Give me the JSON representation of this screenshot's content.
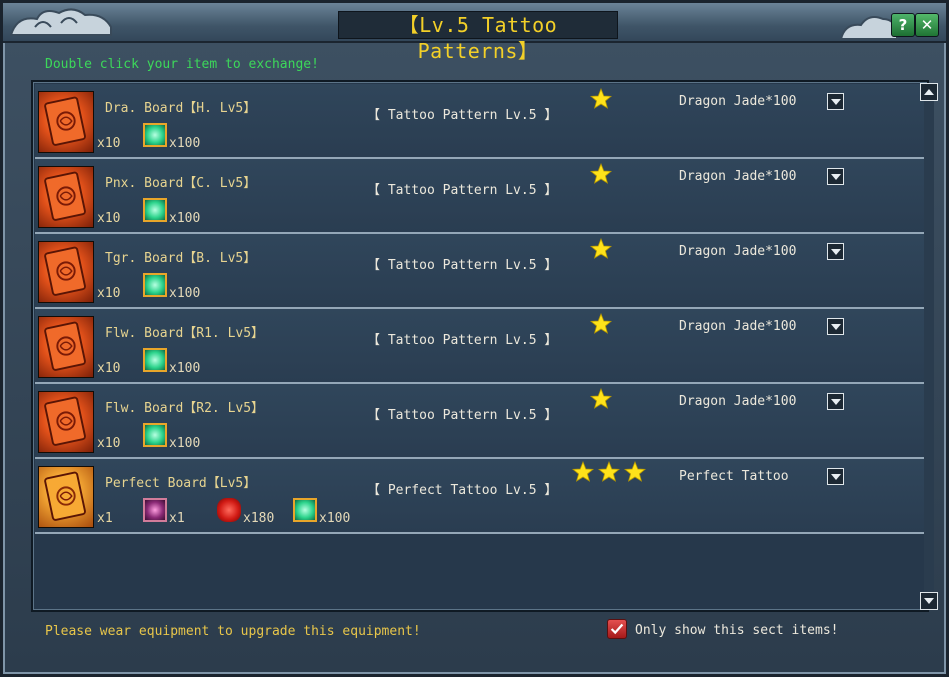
{
  "window": {
    "title": "【Lv.5 Tattoo Patterns】",
    "hint": "Double click your item to exchange!",
    "help_label": "?",
    "close_label": "✕"
  },
  "rows": [
    {
      "item_name": "Dra. Board【H. Lv5】",
      "item_qty": "x10",
      "materials": [
        {
          "type": "jade",
          "qty": "x100"
        }
      ],
      "pattern": "【 Tattoo Pattern Lv.5 】",
      "stars": 1,
      "cost": "Dragon Jade*100"
    },
    {
      "item_name": "Pnx. Board【C. Lv5】",
      "item_qty": "x10",
      "materials": [
        {
          "type": "jade",
          "qty": "x100"
        }
      ],
      "pattern": "【 Tattoo Pattern Lv.5 】",
      "stars": 1,
      "cost": "Dragon Jade*100"
    },
    {
      "item_name": "Tgr. Board【B. Lv5】",
      "item_qty": "x10",
      "materials": [
        {
          "type": "jade",
          "qty": "x100"
        }
      ],
      "pattern": "【 Tattoo Pattern Lv.5 】",
      "stars": 1,
      "cost": "Dragon Jade*100"
    },
    {
      "item_name": "Flw. Board【R1. Lv5】",
      "item_qty": "x10",
      "materials": [
        {
          "type": "jade",
          "qty": "x100"
        }
      ],
      "pattern": "【 Tattoo Pattern Lv.5 】",
      "stars": 1,
      "cost": "Dragon Jade*100"
    },
    {
      "item_name": "Flw. Board【R2. Lv5】",
      "item_qty": "x10",
      "materials": [
        {
          "type": "jade",
          "qty": "x100"
        }
      ],
      "pattern": "【 Tattoo Pattern Lv.5 】",
      "stars": 1,
      "cost": "Dragon Jade*100"
    },
    {
      "item_name": "Perfect Board【Lv5】",
      "item_qty": "x1",
      "materials": [
        {
          "type": "purple",
          "qty": "x1"
        },
        {
          "type": "redgem",
          "qty": "x180"
        },
        {
          "type": "jade",
          "qty": "x100"
        }
      ],
      "pattern": "【 Perfect Tattoo Lv.5 】",
      "stars": 3,
      "cost": "Perfect Tattoo"
    }
  ],
  "footer": {
    "message": "Please wear equipment to upgrade this equipment!",
    "checkbox_label": "Only show this sect items!",
    "checkbox_checked": true
  },
  "colors": {
    "title_text": "#f3d028",
    "hint_text": "#3cd85a",
    "star": "#ffe21a",
    "footer_text": "#e8c64a"
  },
  "icons": {
    "help": "help-icon",
    "close": "close-icon",
    "dropdown": "chevron-down-icon",
    "scroll_up": "chevron-up-icon",
    "scroll_down": "chevron-down-icon",
    "star": "star-icon",
    "checkbox": "checkmark-icon"
  }
}
